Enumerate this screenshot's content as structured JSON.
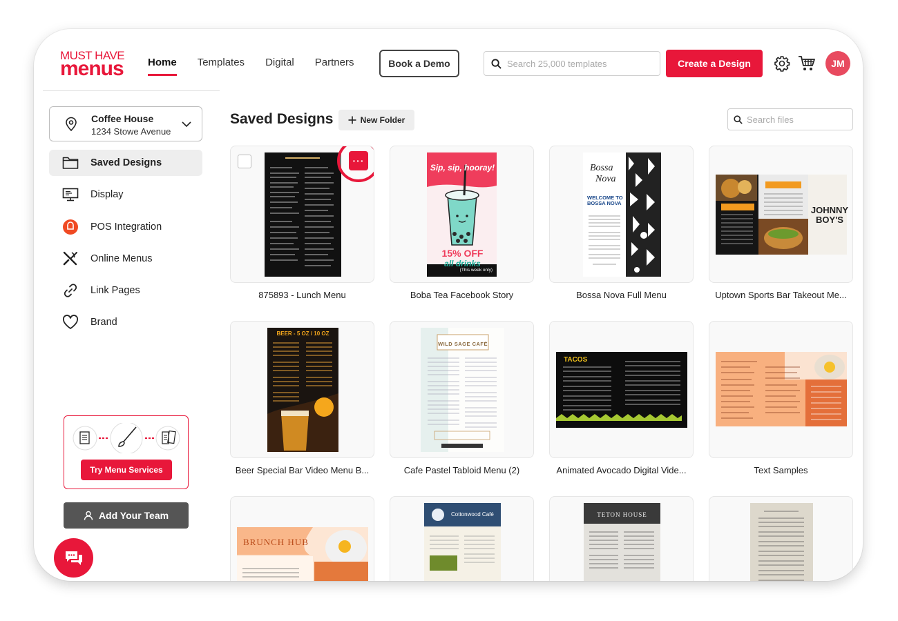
{
  "logo": {
    "line1": "MUST HAVE",
    "line2": "menus"
  },
  "nav": {
    "items": [
      {
        "label": "Home",
        "active": true
      },
      {
        "label": "Templates",
        "active": false
      },
      {
        "label": "Digital",
        "active": false
      },
      {
        "label": "Partners",
        "active": false
      }
    ]
  },
  "header": {
    "demo_label": "Book a Demo",
    "search_placeholder": "Search 25,000 templates",
    "create_label": "Create a Design",
    "avatar_initials": "JM"
  },
  "location": {
    "name": "Coffee House",
    "address": "1234 Stowe Avenue"
  },
  "sidebar": {
    "items": [
      {
        "label": "Saved Designs",
        "icon": "folder-icon",
        "active": true
      },
      {
        "label": "Display",
        "icon": "display-icon",
        "active": false
      },
      {
        "label": "POS Integration",
        "icon": "pos-icon",
        "active": false
      },
      {
        "label": "Online Menus",
        "icon": "utensils-icon",
        "active": false
      },
      {
        "label": "Link Pages",
        "icon": "link-icon",
        "active": false
      },
      {
        "label": "Brand",
        "icon": "heart-icon",
        "active": false
      }
    ]
  },
  "promo": {
    "button_label": "Try Menu Services"
  },
  "team": {
    "button_label": "Add Your Team"
  },
  "main": {
    "title": "Saved Designs",
    "new_folder_label": "New Folder",
    "file_search_placeholder": "Search files"
  },
  "designs": [
    {
      "title": "875893 - Lunch Menu",
      "thumb": "dark-menu",
      "selected_more": true
    },
    {
      "title": "Boba Tea Facebook Story",
      "thumb": "boba",
      "promo_text": "Sip, sip, hooray!",
      "offer": "15% OFF",
      "offer_sub": "all drinks",
      "note": "(This week only)"
    },
    {
      "title": "Bossa Nova Full Menu",
      "thumb": "bossa",
      "heading": "WELCOME TO BOSSA NOVA"
    },
    {
      "title": "Uptown Sports Bar Takeout Me...",
      "thumb": "sports",
      "brand": "JOHNNY BOY'S"
    },
    {
      "title": "Beer Special Bar Video Menu B...",
      "thumb": "beer",
      "heading": "BEER - 5 OZ / 10 OZ"
    },
    {
      "title": "Cafe Pastel Tabloid Menu (2)",
      "thumb": "pastel",
      "heading": "WILD SAGE CAFÉ"
    },
    {
      "title": "Animated Avocado Digital Vide...",
      "thumb": "tacos",
      "heading": "TACOS"
    },
    {
      "title": "Text Samples",
      "thumb": "text-samples"
    },
    {
      "title": "",
      "thumb": "brunch",
      "heading": "BRUNCH HUB"
    },
    {
      "title": "",
      "thumb": "cottonwood",
      "heading": "Cottonwood Café"
    },
    {
      "title": "",
      "thumb": "teton",
      "heading": "TETON HOUSE"
    },
    {
      "title": "",
      "thumb": "beige"
    }
  ],
  "colors": {
    "accent": "#e8173a",
    "dark_button": "#555555"
  }
}
